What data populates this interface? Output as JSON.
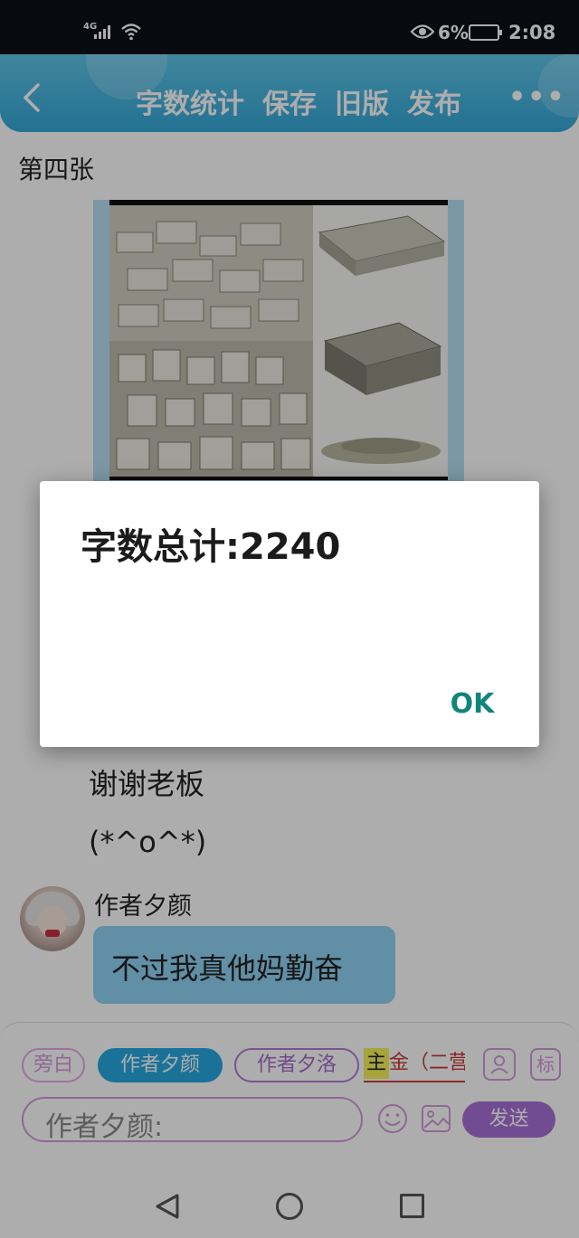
{
  "status_bar": {
    "network": "4G",
    "battery": "6%",
    "time": "2:08"
  },
  "toolbar": {
    "items": [
      "字数统计",
      "保存",
      "旧版",
      "发布"
    ],
    "more": "•••"
  },
  "content": {
    "section_title": "第四张",
    "lines": [
      "谢谢老板",
      "(*^o^*)"
    ],
    "author_name": "作者夕颜",
    "bubble_text": "不过我真他妈勤奋"
  },
  "composer": {
    "roles": {
      "narration": "旁白",
      "author1": "作者夕颜",
      "author2": "作者夕洛",
      "gold_highlight": "主",
      "gold_rest": "金（二营"
    },
    "small_icon_label": "标",
    "input_placeholder": "作者夕颜:",
    "send": "发送"
  },
  "dialog": {
    "message": "字数总计:2240",
    "ok": "OK"
  }
}
